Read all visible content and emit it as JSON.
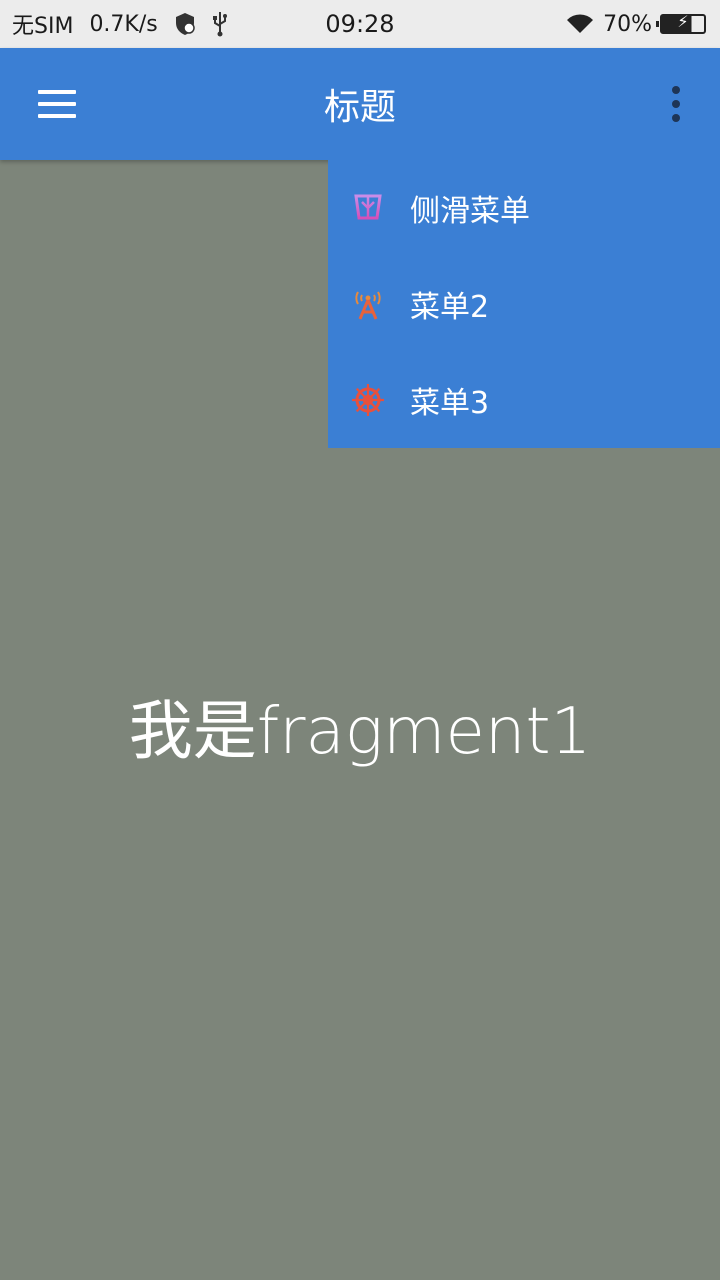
{
  "status_bar": {
    "carrier": "无SIM",
    "speed": "0.7K/s",
    "time": "09:28",
    "battery": "70%",
    "icons": [
      "shield-icon",
      "usb-icon",
      "wifi-icon",
      "battery-icon"
    ]
  },
  "app_bar": {
    "title": "标题",
    "menu_icon": "hamburger-menu-icon",
    "overflow_icon": "more-vert-icon",
    "background": "#3b7fd4"
  },
  "popup_menu": {
    "items": [
      {
        "label": "侧滑菜单",
        "icon": "ship-icon"
      },
      {
        "label": "菜单2",
        "icon": "antenna-icon"
      },
      {
        "label": "菜单3",
        "icon": "ship-wheel-icon"
      }
    ]
  },
  "content": {
    "text": "我是fragment1",
    "background": "#7d857a"
  }
}
